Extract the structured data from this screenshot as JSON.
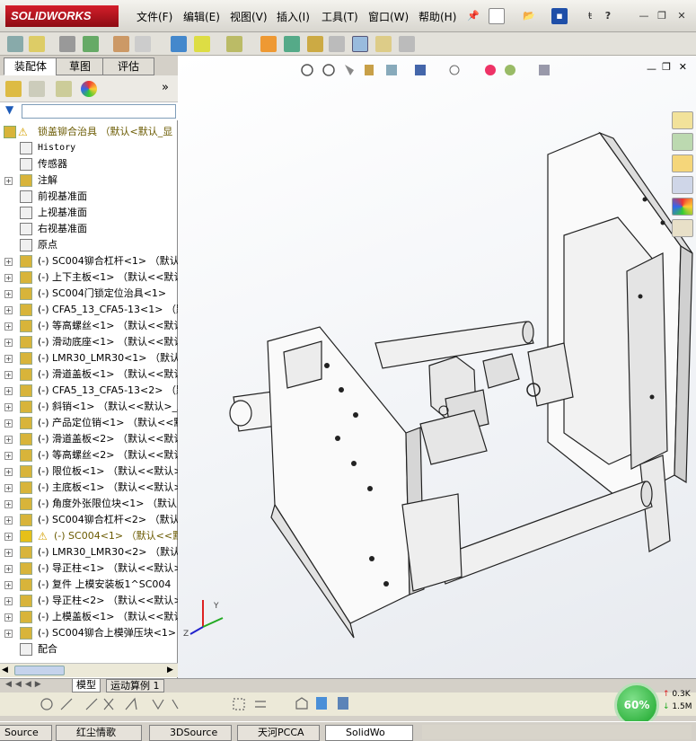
{
  "app": {
    "logo": "SOLIDWORKS"
  },
  "menu": [
    "文件(F)",
    "编辑(E)",
    "视图(V)",
    "插入(I)",
    "工具(T)",
    "窗口(W)",
    "帮助(H)"
  ],
  "tabs": [
    "装配体",
    "草图",
    "评估"
  ],
  "tree": {
    "root": "锁盖铆合治具 （默认<默认_显",
    "items": [
      {
        "text": "History",
        "mono": true
      },
      {
        "text": "传感器"
      },
      {
        "text": "注解",
        "exp": true
      },
      {
        "text": "前视基准面"
      },
      {
        "text": "上视基准面"
      },
      {
        "text": "右视基准面"
      },
      {
        "text": "原点"
      },
      {
        "text": "(-) SC004铆合杠杆<1> （默认<",
        "exp": true
      },
      {
        "text": "(-) 上下主板<1> （默认<<默认",
        "exp": true
      },
      {
        "text": "(-) SC004门锁定位治具<1>",
        "exp": true
      },
      {
        "text": "(-) CFA5_13_CFA5-13<1> （默",
        "exp": true
      },
      {
        "text": "(-) 等高螺丝<1> （默认<<默认",
        "exp": true
      },
      {
        "text": "(-) 滑动底座<1> （默认<<默认",
        "exp": true
      },
      {
        "text": "(-) LMR30_LMR30<1> （默认<<",
        "exp": true
      },
      {
        "text": "(-) 滑道盖板<1> （默认<<默认",
        "exp": true
      },
      {
        "text": "(-) CFA5_13_CFA5-13<2> （默",
        "exp": true
      },
      {
        "text": "(-) 斜销<1> （默认<<默认>_显",
        "exp": true
      },
      {
        "text": "(-) 产品定位销<1> （默认<<默",
        "exp": true
      },
      {
        "text": "(-) 滑道盖板<2> （默认<<默认",
        "exp": true
      },
      {
        "text": "(-) 等高螺丝<2> （默认<<默认",
        "exp": true
      },
      {
        "text": "(-) 限位板<1> （默认<<默认>_",
        "exp": true
      },
      {
        "text": "(-) 主底板<1> （默认<<默认>_",
        "exp": true
      },
      {
        "text": "(-) 角度外张限位块<1> （默认",
        "exp": true
      },
      {
        "text": "(-) SC004铆合杠杆<2> （默认<",
        "exp": true
      },
      {
        "text": "(-) SC004<1> （默认<<默认>_",
        "exp": true,
        "warn": true
      },
      {
        "text": "(-) LMR30_LMR30<2> （默认<<",
        "exp": true
      },
      {
        "text": "(-) 导正柱<1> （默认<<默认>_",
        "exp": true
      },
      {
        "text": "(-) 复件 上模安装板1^SC004",
        "exp": true
      },
      {
        "text": "(-) 导正柱<2> （默认<<默认>_",
        "exp": true
      },
      {
        "text": "(-) 上模盖板<1> （默认<<默认",
        "exp": true
      },
      {
        "text": "(-) SC004铆合上模弹压块<1>",
        "exp": true
      },
      {
        "text": "配合"
      }
    ]
  },
  "bottom_tabs": [
    "模型",
    "运动算例 1"
  ],
  "status": {
    "perf": "60%",
    "net_up": "0.3K",
    "net_down": "1.5M"
  },
  "taskbar": [
    "Source",
    "红尘情歌",
    "3DSource",
    "天河PCCA",
    "SolidWo"
  ]
}
